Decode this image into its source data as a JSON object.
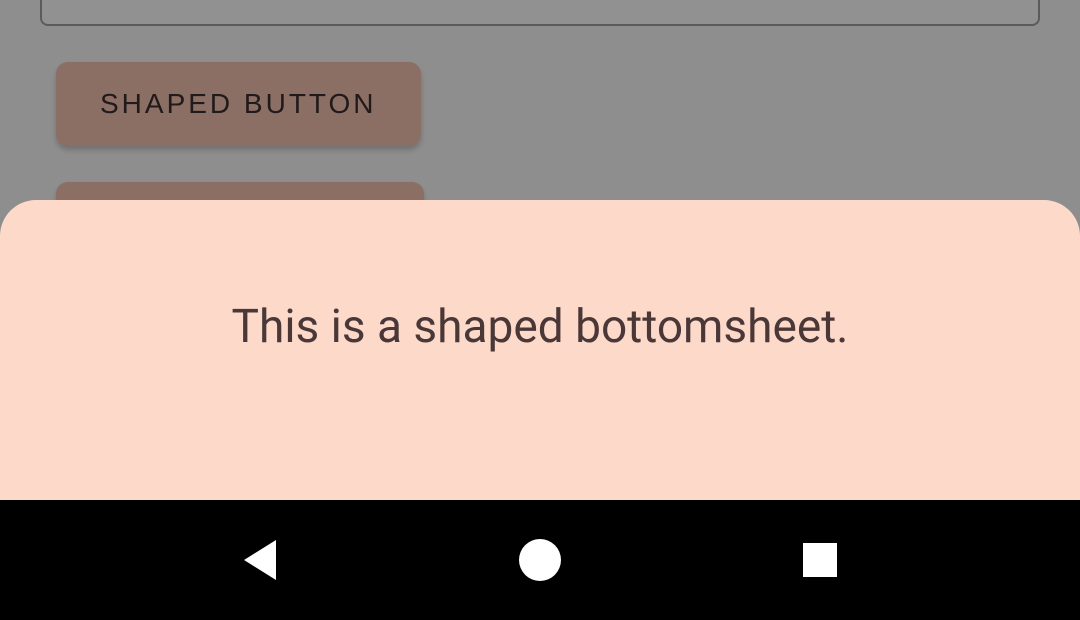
{
  "buttons": {
    "shaped_button_label": "SHAPED BUTTON"
  },
  "bottomsheet": {
    "message": "This is a shaped bottomsheet."
  }
}
